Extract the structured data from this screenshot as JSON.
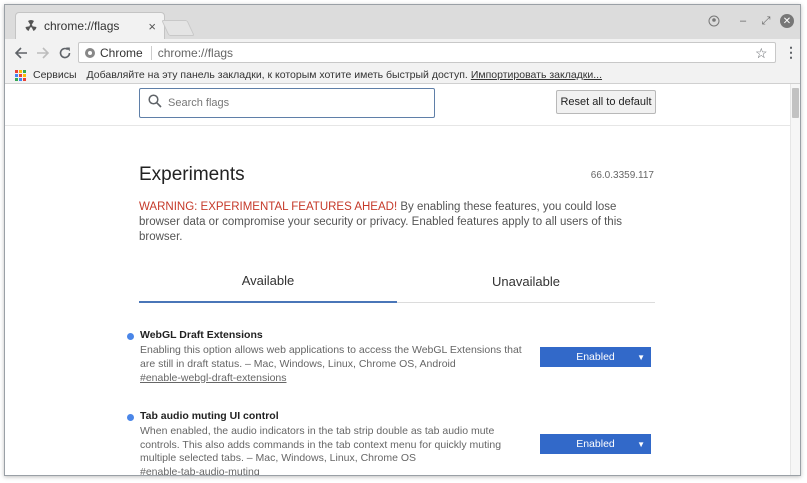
{
  "browser": {
    "tab_title": "chrome://flags",
    "tab_close": "×",
    "omnibox_chip": "Chrome",
    "url": "chrome://flags",
    "window_controls": {
      "minimize": "–",
      "maximize": "⤢",
      "close": "✕"
    }
  },
  "bookmarks": {
    "apps_label": "Сервисы",
    "hint": "Добавляйте на эту панель закладки, к которым хотите иметь быстрый доступ.",
    "import_link": "Импортировать закладки..."
  },
  "page": {
    "search_placeholder": "Search flags",
    "reset_button": "Reset all to default",
    "title": "Experiments",
    "version": "66.0.3359.117",
    "warning_red": "WARNING: EXPERIMENTAL FEATURES AHEAD!",
    "warning_text": " By enabling these features, you could lose browser data or compromise your security or privacy. Enabled features apply to all users of this browser.",
    "tabs": [
      "Available",
      "Unavailable"
    ],
    "active_tab": "Available",
    "experiments": [
      {
        "name": "WebGL Draft Extensions",
        "description": "Enabling this option allows web applications to access the WebGL Extensions that are still in draft status. – Mac, Windows, Linux, Chrome OS, Android",
        "link": "#enable-webgl-draft-extensions",
        "state": "Enabled"
      },
      {
        "name": "Tab audio muting UI control",
        "description": "When enabled, the audio indicators in the tab strip double as tab audio mute controls. This also adds commands in the tab context menu for quickly muting multiple selected tabs. – Mac, Windows, Linux, Chrome OS",
        "link": "#enable-tab-audio-muting",
        "state": "Enabled"
      }
    ]
  },
  "colors": {
    "accent": "#3269c9",
    "warning": "#c53929",
    "dot": "#4a86e8",
    "apps_grid": [
      "#ea4335",
      "#fbbc05",
      "#34a853",
      "#4285f4",
      "#ea4335",
      "#fbbc05",
      "#34a853",
      "#4285f4",
      "#ea4335"
    ]
  }
}
